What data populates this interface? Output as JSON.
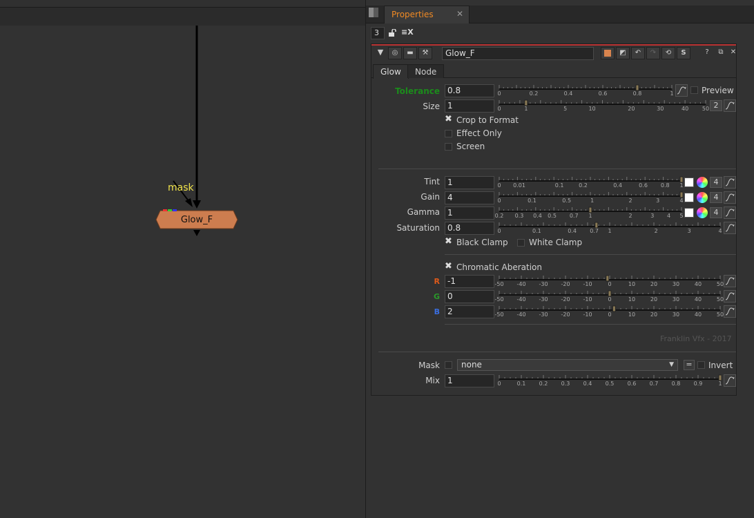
{
  "graph": {
    "node_name": "Glow_F",
    "mask_input_label": "mask"
  },
  "properties_tab": {
    "label": "Properties",
    "close": "✕"
  },
  "panel_header": {
    "count": "3"
  },
  "node_panel": {
    "name": "Glow_F",
    "tabs": [
      "Glow",
      "Node"
    ],
    "tolerance": {
      "label": "Tolerance",
      "value": "0.8",
      "slider_value": 0.8,
      "ticks": [
        "0",
        "0.2",
        "0.4",
        "0.6",
        "0.8",
        "1"
      ]
    },
    "preview_label": "Preview",
    "size": {
      "label": "Size",
      "value": "1",
      "slider_value": 1,
      "ticks": [
        "0",
        "1",
        "5",
        "10",
        "20",
        "30",
        "40",
        "50"
      ],
      "channels": "2"
    },
    "crop_to_format": {
      "label": "Crop to Format",
      "checked": true
    },
    "effect_only": {
      "label": "Effect Only",
      "checked": false
    },
    "screen": {
      "label": "Screen",
      "checked": false
    },
    "tint": {
      "label": "Tint",
      "value": "1",
      "channels": "4",
      "ticks": [
        "0",
        "0.01",
        "0.1",
        "0.2",
        "0.4",
        "0.6",
        "0.8",
        "1"
      ]
    },
    "gain": {
      "label": "Gain",
      "value": "4",
      "channels": "4",
      "ticks": [
        "0",
        "0.1",
        "0.5",
        "1",
        "2",
        "3",
        "4"
      ]
    },
    "gamma": {
      "label": "Gamma",
      "value": "1",
      "channels": "4",
      "ticks": [
        "0.2",
        "0.3",
        "0.4",
        "0.5",
        "0.7",
        "1",
        "2",
        "3",
        "4",
        "5"
      ]
    },
    "saturation": {
      "label": "Saturation",
      "value": "0.8",
      "ticks": [
        "0",
        "0.1",
        "0.4",
        "0.7",
        "1",
        "2",
        "3",
        "4"
      ]
    },
    "black_clamp": {
      "label": "Black Clamp",
      "checked": true
    },
    "white_clamp": {
      "label": "White Clamp",
      "checked": false
    },
    "chromatic_aberation": {
      "label": "Chromatic Aberation",
      "checked": true
    },
    "ca_ticks": [
      "-50",
      "-40",
      "-30",
      "-20",
      "-10",
      "0",
      "10",
      "20",
      "30",
      "40",
      "50"
    ],
    "r": {
      "label": "R",
      "value": "-1",
      "slider_value": -1
    },
    "g": {
      "label": "G",
      "value": "0",
      "slider_value": 0
    },
    "b": {
      "label": "B",
      "value": "2",
      "slider_value": 2
    },
    "credit": "Franklin Vfx - 2017",
    "mask": {
      "label": "Mask",
      "value": "none",
      "eq": "=",
      "invert_label": "Invert"
    },
    "mix": {
      "label": "Mix",
      "value": "1",
      "slider_value": 1,
      "ticks": [
        "0",
        "0.1",
        "0.2",
        "0.3",
        "0.4",
        "0.5",
        "0.6",
        "0.7",
        "0.8",
        "0.9",
        "1"
      ]
    }
  }
}
